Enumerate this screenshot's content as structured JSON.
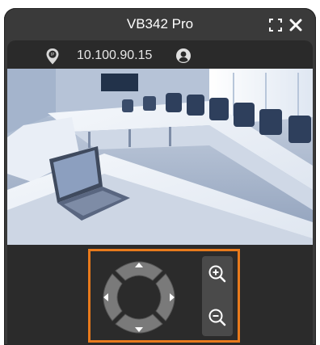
{
  "window": {
    "title": "VB342 Pro"
  },
  "titlebar": {
    "fullscreen_icon": "fullscreen-icon",
    "close_icon": "close-icon"
  },
  "info": {
    "ip_address": "10.100.90.15",
    "ip_icon": "location-pin-icon",
    "user_icon": "user-icon"
  },
  "video": {
    "scene": "conference-room-camera-feed"
  },
  "ptz": {
    "highlight_color": "#e87a1c",
    "directions": [
      "up",
      "down",
      "left",
      "right"
    ],
    "zoom_in_icon": "zoom-in-icon",
    "zoom_out_icon": "zoom-out-icon"
  }
}
